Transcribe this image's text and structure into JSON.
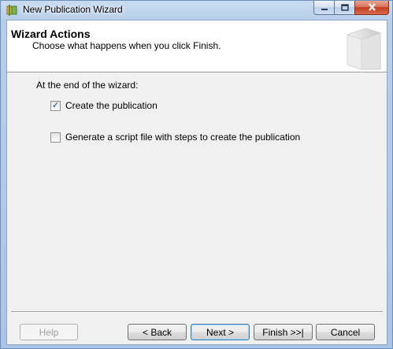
{
  "window": {
    "title": "New Publication Wizard"
  },
  "header": {
    "title": "Wizard Actions",
    "subtitle": "Choose what happens when you click Finish."
  },
  "content": {
    "prompt": "At the end of the wizard:",
    "options": [
      {
        "label": "Create the publication",
        "checked": true
      },
      {
        "label": "Generate a script file with steps to create the publication",
        "checked": false
      }
    ]
  },
  "buttons": {
    "help": "Help",
    "back": "< Back",
    "next": "Next >",
    "finish": "Finish >>|",
    "cancel": "Cancel"
  },
  "icons": {
    "app": "publication-wizard-icon",
    "minimize": "minimize-icon",
    "maximize": "maximize-icon",
    "close": "close-icon",
    "checkmark": "✓"
  }
}
